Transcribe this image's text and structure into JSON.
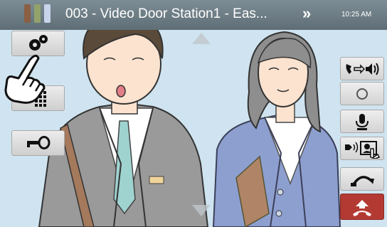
{
  "header": {
    "title": "003 - Video Door Station1 - Eas...",
    "more_glyph": "»",
    "time": "10:25 AM",
    "signal_colors": [
      "#8a5f44",
      "#93a26a",
      "#c8d4ea"
    ]
  },
  "left_buttons": [
    {
      "icon": "settings-gear-icon"
    },
    {
      "icon": "keypad-icon"
    },
    {
      "icon": "door-release-key-icon"
    }
  ],
  "right_buttons": [
    {
      "icon": "speaker-volume-icon"
    },
    {
      "icon": "record-icon"
    },
    {
      "icon": "microphone-icon"
    },
    {
      "icon": "push-to-talk-icon"
    },
    {
      "icon": "call-transfer-icon"
    },
    {
      "icon": "hang-up-icon"
    }
  ],
  "pan_arrows": {
    "up": "up-arrow-icon",
    "down": "down-arrow-icon"
  },
  "overlay": {
    "hand": "tap-hand-icon"
  },
  "colors": {
    "hangup": "#b33a32",
    "background": "#cfe4f0",
    "man_suit": "#9a9a9a",
    "woman_suit": "#8d9fcf"
  }
}
